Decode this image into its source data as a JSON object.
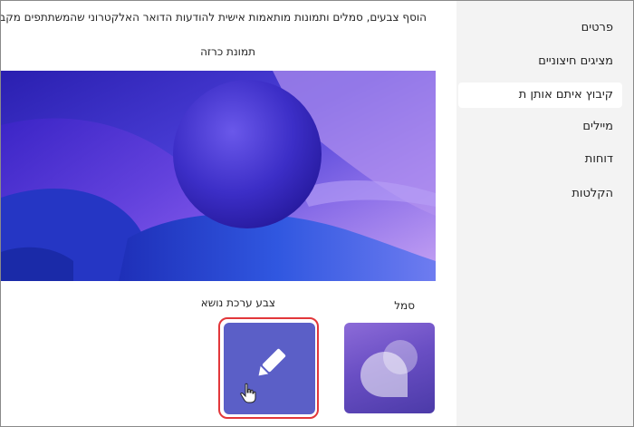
{
  "sidebar": {
    "items": [
      {
        "label": "פרטים",
        "active": false
      },
      {
        "label": "מציגים חיצוניים",
        "active": false
      },
      {
        "label": "קיבוץ איתם אותן ת",
        "active": true
      },
      {
        "label": "מיילים",
        "active": false
      },
      {
        "label": "דוחות",
        "active": false
      },
      {
        "label": "הקלטות",
        "active": false
      }
    ]
  },
  "main": {
    "description": "הוסף צבעים, סמלים ותמונות מותאמות אישית להודעות הדואר האלקטרוני שהמשתתפים מקבלים.",
    "cover_label": "תמונת כרזה",
    "logo_label": "סמל",
    "theme_label": "צבע ערכת נושא"
  },
  "colors": {
    "sidebar_bg": "#f3f3f3",
    "theme_color": "#5b5fc7",
    "highlight": "#e2373b",
    "cover_primary": "#4a3bd6"
  },
  "icons": {
    "theme_tile": "pencil-icon",
    "pointer": "hand-pointer-icon",
    "logo": "teams-bubbles-icon"
  }
}
